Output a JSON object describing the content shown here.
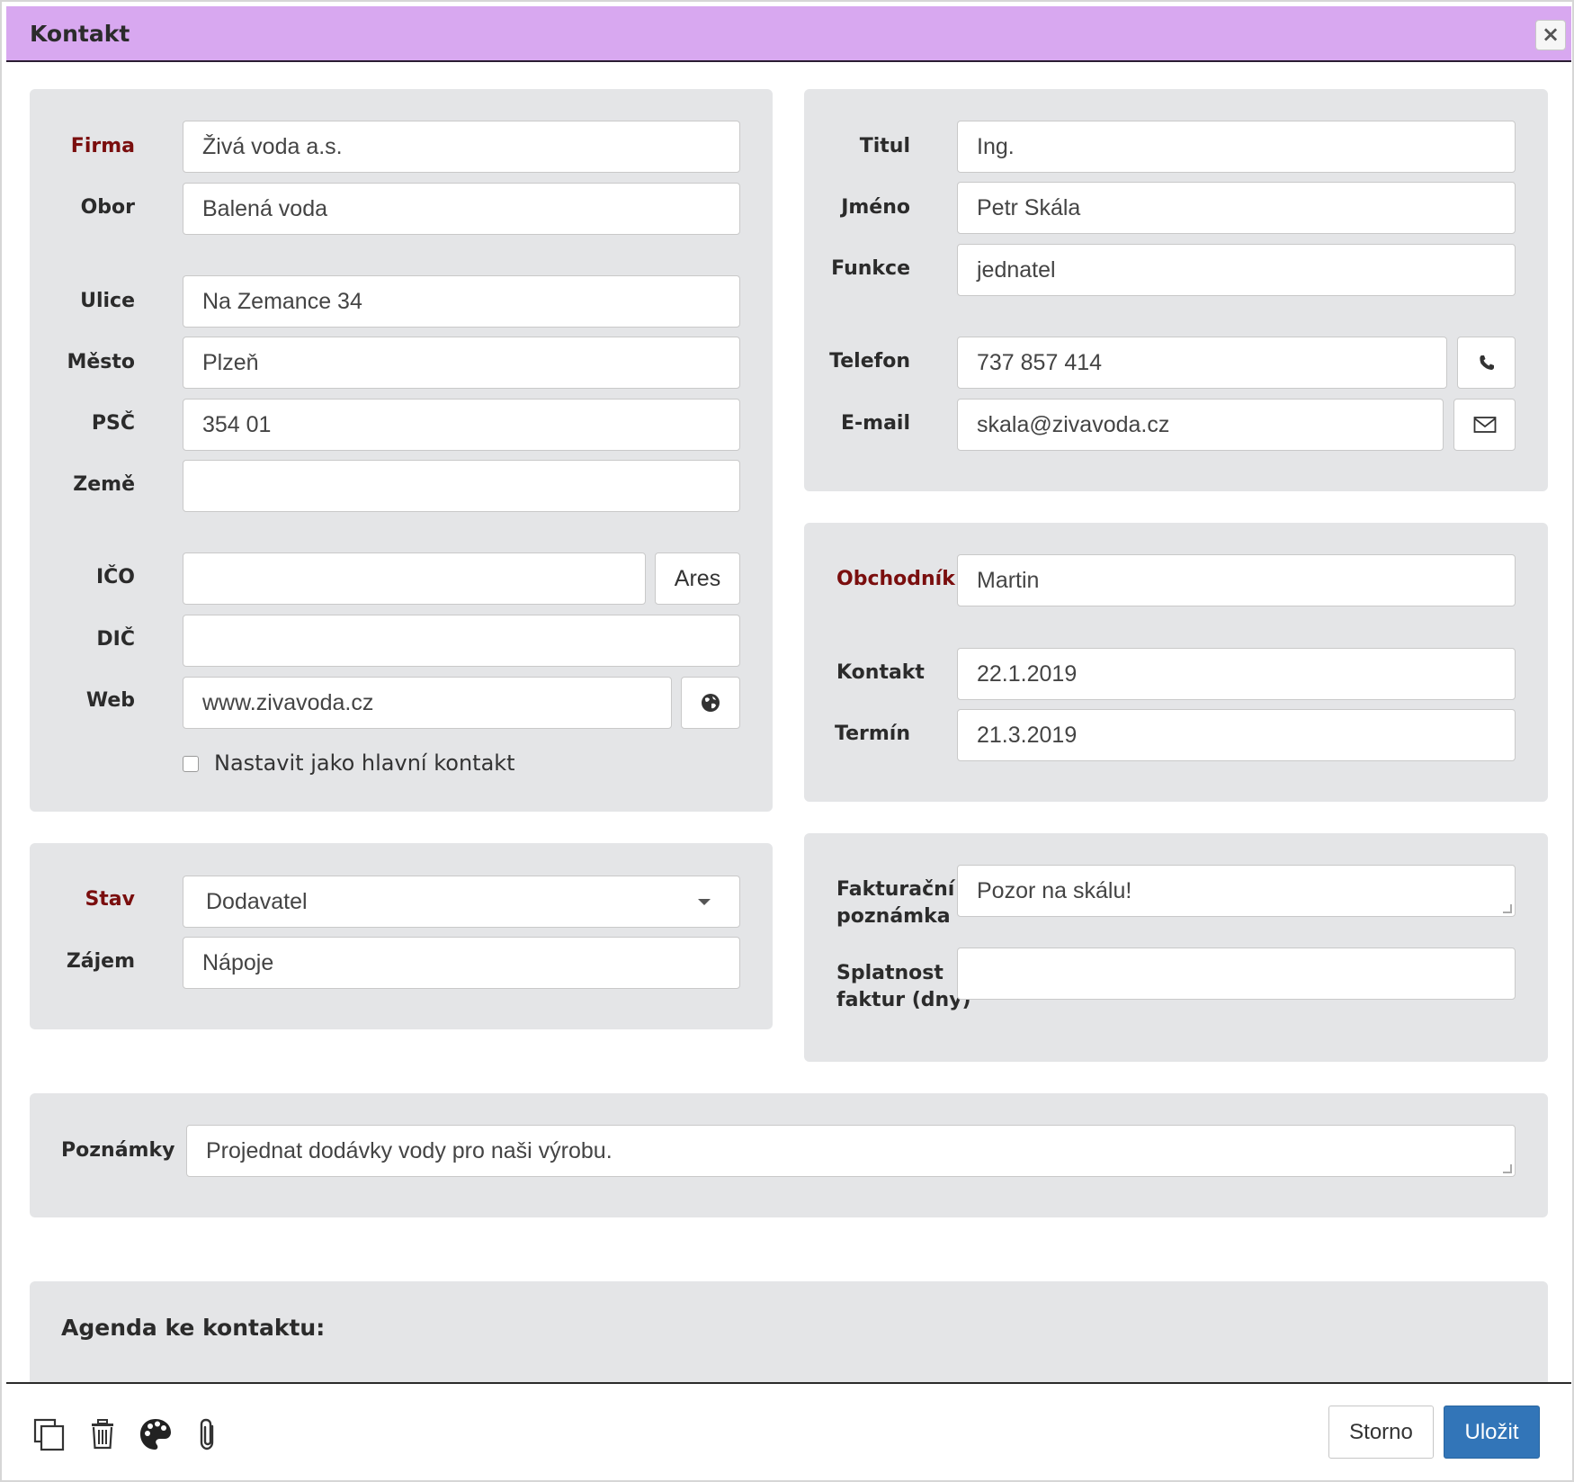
{
  "window": {
    "title": "Kontakt",
    "close_label": "×",
    "header_color": "#d8a8f0"
  },
  "company": {
    "firma": {
      "label": "Firma",
      "value": "Živá voda a.s."
    },
    "obor": {
      "label": "Obor",
      "value": "Balená voda"
    },
    "ulice": {
      "label": "Ulice",
      "value": "Na Zemance 34"
    },
    "mesto": {
      "label": "Město",
      "value": "Plzeň"
    },
    "psc": {
      "label": "PSČ",
      "value": "354 01"
    },
    "zeme": {
      "label": "Země",
      "value": ""
    },
    "ico": {
      "label": "IČO",
      "value": ""
    },
    "ares_button": "Ares",
    "dic": {
      "label": "DIČ",
      "value": ""
    },
    "web": {
      "label": "Web",
      "value": "www.zivavoda.cz"
    },
    "web_icon": "globe-icon",
    "main_contact_label": "Nastavit jako hlavní kontakt",
    "main_contact_checked": false
  },
  "person": {
    "titul": {
      "label": "Titul",
      "value": "Ing."
    },
    "jmeno": {
      "label": "Jméno",
      "value": "Petr Skála"
    },
    "funkce": {
      "label": "Funkce",
      "value": "jednatel"
    },
    "telefon": {
      "label": "Telefon",
      "value": "737 857 414"
    },
    "phone_icon": "phone-icon",
    "email": {
      "label": "E-mail",
      "value": "skala@zivavoda.cz"
    },
    "email_icon": "envelope-icon"
  },
  "sales": {
    "obchodnik": {
      "label": "Obchodník",
      "value": "Martin"
    },
    "kontakt": {
      "label": "Kontakt",
      "value": "22.1.2019"
    },
    "termin": {
      "label": "Termín",
      "value": "21.3.2019"
    }
  },
  "status": {
    "stav": {
      "label": "Stav",
      "value": "Dodavatel"
    },
    "zajem": {
      "label": "Zájem",
      "value": "Nápoje"
    }
  },
  "billing": {
    "poznamka": {
      "label_line1": "Fakturační",
      "label_line2": "poznámka",
      "value": "Pozor na skálu!"
    },
    "splatnost": {
      "label_line1": "Splatnost",
      "label_line2": "faktur (dny)",
      "value": ""
    }
  },
  "notes": {
    "label": "Poznámky",
    "value": "Projednat dodávky vody pro naši výrobu."
  },
  "agenda": {
    "title": "Agenda ke kontaktu:"
  },
  "footer": {
    "icons": [
      "copy-icon",
      "trash-icon",
      "palette-icon",
      "paperclip-icon"
    ],
    "cancel_label": "Storno",
    "save_label": "Uložit",
    "save_color": "#3275b8"
  },
  "colors": {
    "panel": "#e4e5e7",
    "required_label": "#7a0e0e"
  }
}
